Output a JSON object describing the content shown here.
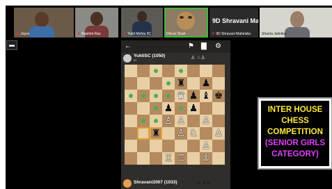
{
  "participants": [
    {
      "name": "Joyce",
      "mic_muted": true
    },
    {
      "name": "Rashmi Rao",
      "mic_muted": true
    },
    {
      "name": "Yukti Mehta 9C",
      "mic_muted": true
    },
    {
      "name": "Dhruvi Shah",
      "mic_muted": false
    },
    {
      "name": "9D Shravani Mahindra",
      "mic_muted": true,
      "display_title": "9D Shravani Ma..."
    },
    {
      "name": "Shanta Jaitnikar",
      "mic_muted": false
    }
  ],
  "chess": {
    "opponent": {
      "name": "YuktiSC (1050)",
      "sub": "8C"
    },
    "player": {
      "name": "Shravani2007 (1033)"
    },
    "board": [
      [
        "",
        "",
        "",
        "",
        "",
        "",
        "",
        ""
      ],
      [
        "",
        "",
        "",
        "",
        "",
        "",
        "",
        "bp"
      ],
      [
        "",
        "",
        "",
        "",
        "",
        "",
        "",
        ""
      ],
      [
        "",
        "",
        "",
        "",
        "",
        "",
        "",
        ""
      ],
      [
        "",
        "",
        "",
        "",
        "",
        "",
        "",
        ""
      ],
      [
        "",
        "",
        "",
        "",
        "",
        "",
        "",
        ""
      ],
      [
        "",
        "",
        "",
        "",
        "",
        "",
        "",
        ""
      ],
      [
        "",
        "",
        "",
        "",
        "",
        "",
        "",
        ""
      ]
    ],
    "pieces": [
      {
        "sq": "e7",
        "glyph": "♜",
        "side": "b"
      },
      {
        "sq": "g7",
        "glyph": "♟",
        "side": "b"
      },
      {
        "sq": "e6",
        "glyph": "♛",
        "side": "w"
      },
      {
        "sq": "f6",
        "glyph": "♟",
        "side": "b"
      },
      {
        "sq": "g6",
        "glyph": "♝",
        "side": "b"
      },
      {
        "sq": "h6",
        "glyph": "♚",
        "side": "b"
      },
      {
        "sq": "f5",
        "glyph": "♟",
        "side": "b"
      },
      {
        "sq": "d5",
        "glyph": "♟",
        "side": "b"
      },
      {
        "sq": "d4",
        "glyph": "♙",
        "side": "w"
      },
      {
        "sq": "e4",
        "glyph": "♙",
        "side": "w"
      },
      {
        "sq": "g4",
        "glyph": "♙",
        "side": "w"
      },
      {
        "sq": "c3",
        "glyph": "♜",
        "side": "b"
      },
      {
        "sq": "e3",
        "glyph": "♙",
        "side": "w"
      },
      {
        "sq": "f3",
        "glyph": "♘",
        "side": "w"
      },
      {
        "sq": "h3",
        "glyph": "♙",
        "side": "w"
      },
      {
        "sq": "g2",
        "glyph": "♙",
        "side": "w"
      },
      {
        "sq": "d1",
        "glyph": "♖",
        "side": "w"
      },
      {
        "sq": "e1",
        "glyph": "♖",
        "side": "w"
      },
      {
        "sq": "g1",
        "glyph": "♔",
        "side": "w"
      }
    ],
    "dots": [
      "c8",
      "e8",
      "d7",
      "c6",
      "d6",
      "b6",
      "a6",
      "d5",
      "c5",
      "e4",
      "c4",
      "e5",
      "b4"
    ],
    "selected": [
      "b3",
      "c3"
    ]
  },
  "banner": {
    "lines": [
      "INTER HOUSE",
      "CHESS",
      "COMPETITION",
      "(SENIOR GIRLS",
      "CATEGORY)"
    ],
    "colors": [
      "#ffeb3b",
      "#ffeb3b",
      "#ffeb3b",
      "#e040fb",
      "#e040fb"
    ]
  }
}
